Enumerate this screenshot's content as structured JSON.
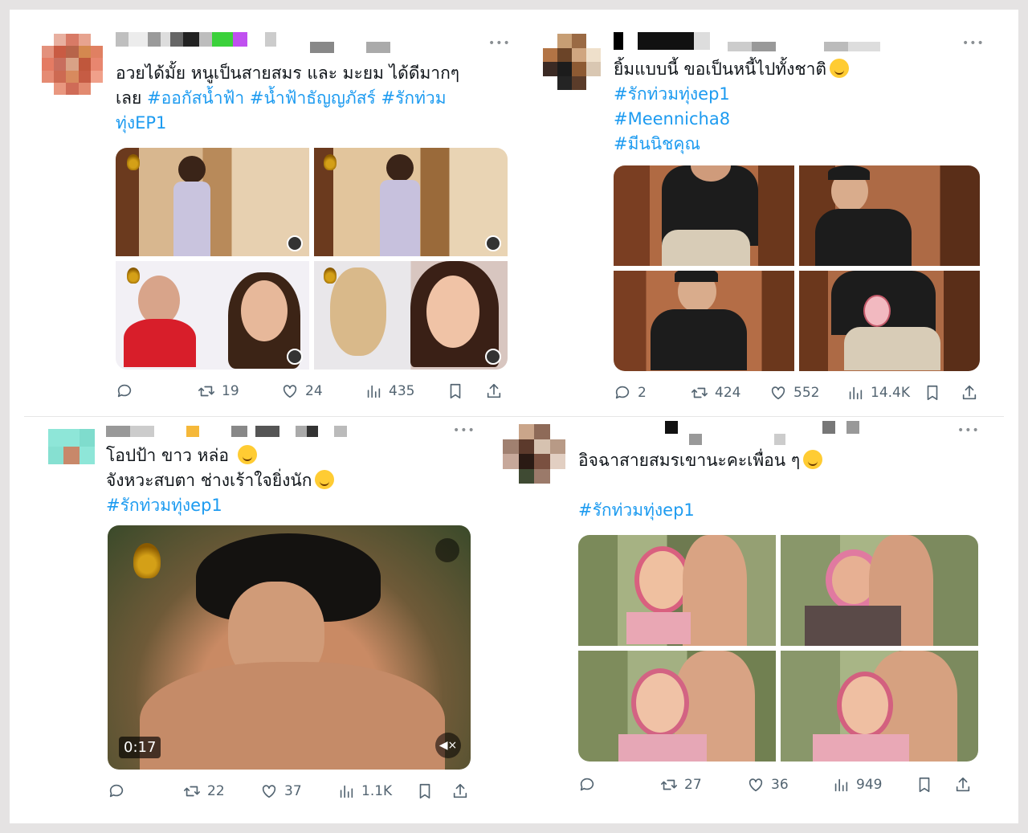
{
  "tweets": [
    {
      "lines": [
        [
          {
            "t": "อวยได้มั้ย หนูเป็นสายสมร และ มะยม ได้ดีมากๆ",
            "tag": false
          }
        ],
        [
          {
            "t": "เลย ",
            "tag": false
          },
          {
            "t": "#ออกัสน้ำฟ้า #น้ำฟ้าธัญญภัสร์ #รักท่วม",
            "tag": true
          }
        ],
        [
          {
            "t": "ทุ่งEP1",
            "tag": true
          }
        ]
      ],
      "actions": {
        "reply": "",
        "retweet": "19",
        "like": "24",
        "views": "435"
      }
    },
    {
      "lines": [
        [
          {
            "t": "ยิ้มแบบนี้ ขอเป็นหนี้ไปทั้งชาติ",
            "tag": false,
            "emoji": true
          }
        ],
        [
          {
            "t": "#รักท่วมทุ่งep1",
            "tag": true
          }
        ],
        [
          {
            "t": "#Meennicha8",
            "tag": true
          }
        ],
        [
          {
            "t": "#มีนนิชคุณ",
            "tag": true
          }
        ]
      ],
      "actions": {
        "reply": "2",
        "retweet": "424",
        "like": "552",
        "views": "14.4K"
      }
    },
    {
      "lines": [
        [
          {
            "t": "โอปป้า ขาว หล่อ ",
            "tag": false,
            "emoji": true
          }
        ],
        [
          {
            "t": "จังหวะสบตา ช่างเร้าใจยิ่งนัก",
            "tag": false,
            "emoji": true
          }
        ],
        [
          {
            "t": "#รักท่วมทุ่งep1",
            "tag": true
          }
        ]
      ],
      "video_time": "0:17",
      "actions": {
        "reply": "",
        "retweet": "22",
        "like": "37",
        "views": "1.1K"
      }
    },
    {
      "lines": [
        [
          {
            "t": "อิจฉาสายสมรเขานะคะเพื่อน ๆ",
            "tag": false,
            "emoji": true
          }
        ],
        [
          {
            "t": "",
            "tag": false
          }
        ],
        [
          {
            "t": "#รักท่วมทุ่งep1",
            "tag": true
          }
        ]
      ],
      "actions": {
        "reply": "",
        "retweet": "27",
        "like": "36",
        "views": "949"
      }
    }
  ],
  "colors": {
    "accent": "#1d9bf0",
    "text": "#0f1419",
    "muted": "#536471"
  },
  "icons": [
    "reply-icon",
    "retweet-icon",
    "like-icon",
    "views-icon",
    "bookmark-icon",
    "share-icon",
    "more-icon",
    "mute-icon",
    "gif-icon"
  ]
}
